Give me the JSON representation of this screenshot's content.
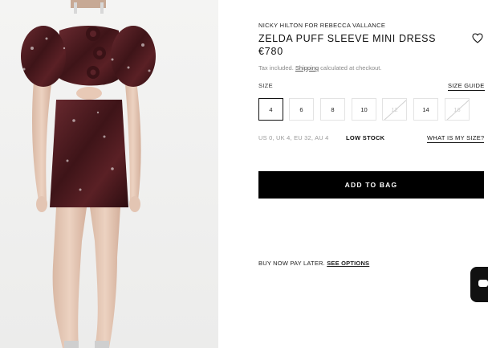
{
  "product": {
    "brand": "NICKY HILTON FOR REBECCA VALLANCE",
    "title": "ZELDA PUFF SLEEVE MINI DRESS",
    "price": "€780",
    "tax_prefix": "Tax included. ",
    "tax_link": "Shipping",
    "tax_suffix": " calculated at checkout.",
    "wishlist_icon": "heart-icon"
  },
  "size": {
    "label": "SIZE",
    "guide_label": "SIZE GUIDE",
    "options": [
      {
        "label": "4",
        "state": "selected"
      },
      {
        "label": "6",
        "state": "available"
      },
      {
        "label": "8",
        "state": "available"
      },
      {
        "label": "10",
        "state": "available"
      },
      {
        "label": "12",
        "state": "sold-out"
      },
      {
        "label": "14",
        "state": "available"
      },
      {
        "label": "16",
        "state": "sold-out"
      }
    ],
    "conversion": "US 0, UK 4, EU 32, AU 4",
    "stock_status": "LOW STOCK",
    "what_is_my_size": "WHAT IS MY SIZE?"
  },
  "cart": {
    "add_label": "ADD TO BAG"
  },
  "payment": {
    "bnpl_text": "BUY NOW PAY LATER. ",
    "bnpl_link": "SEE OPTIONS"
  },
  "colors": {
    "dress": "#4a1c1f",
    "button": "#000000",
    "muted": "#9a9a9a"
  },
  "chat_icon": "chat-icon"
}
